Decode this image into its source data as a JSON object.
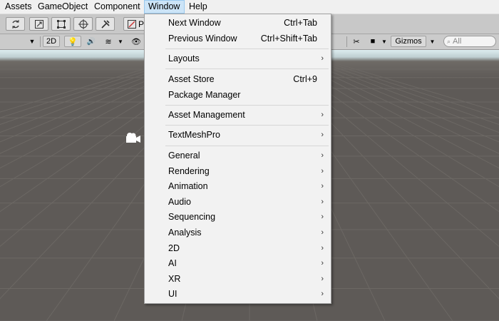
{
  "menubar": {
    "items": [
      "Assets",
      "GameObject",
      "Component",
      "Window",
      "Help"
    ]
  },
  "toolbar": {
    "pivot_partial": "P"
  },
  "scene_toolbar": {
    "mode_2d": "2D",
    "gizmos_label": "Gizmos",
    "search_placeholder": "All"
  },
  "window_menu": {
    "items": [
      {
        "label": "Next Window",
        "shortcut": "Ctrl+Tab"
      },
      {
        "label": "Previous Window",
        "shortcut": "Ctrl+Shift+Tab"
      },
      {
        "label": "Layouts",
        "submenu": true
      },
      {
        "label": "Asset Store",
        "shortcut": "Ctrl+9"
      },
      {
        "label": "Package Manager"
      },
      {
        "label": "Asset Management",
        "submenu": true
      },
      {
        "label": "TextMeshPro",
        "submenu": true
      },
      {
        "label": "General",
        "submenu": true
      },
      {
        "label": "Rendering",
        "submenu": true
      },
      {
        "label": "Animation",
        "submenu": true
      },
      {
        "label": "Audio",
        "submenu": true
      },
      {
        "label": "Sequencing",
        "submenu": true
      },
      {
        "label": "Analysis",
        "submenu": true
      },
      {
        "label": "2D",
        "submenu": true
      },
      {
        "label": "AI",
        "submenu": true
      },
      {
        "label": "XR",
        "submenu": true
      },
      {
        "label": "UI",
        "submenu": true
      }
    ]
  }
}
